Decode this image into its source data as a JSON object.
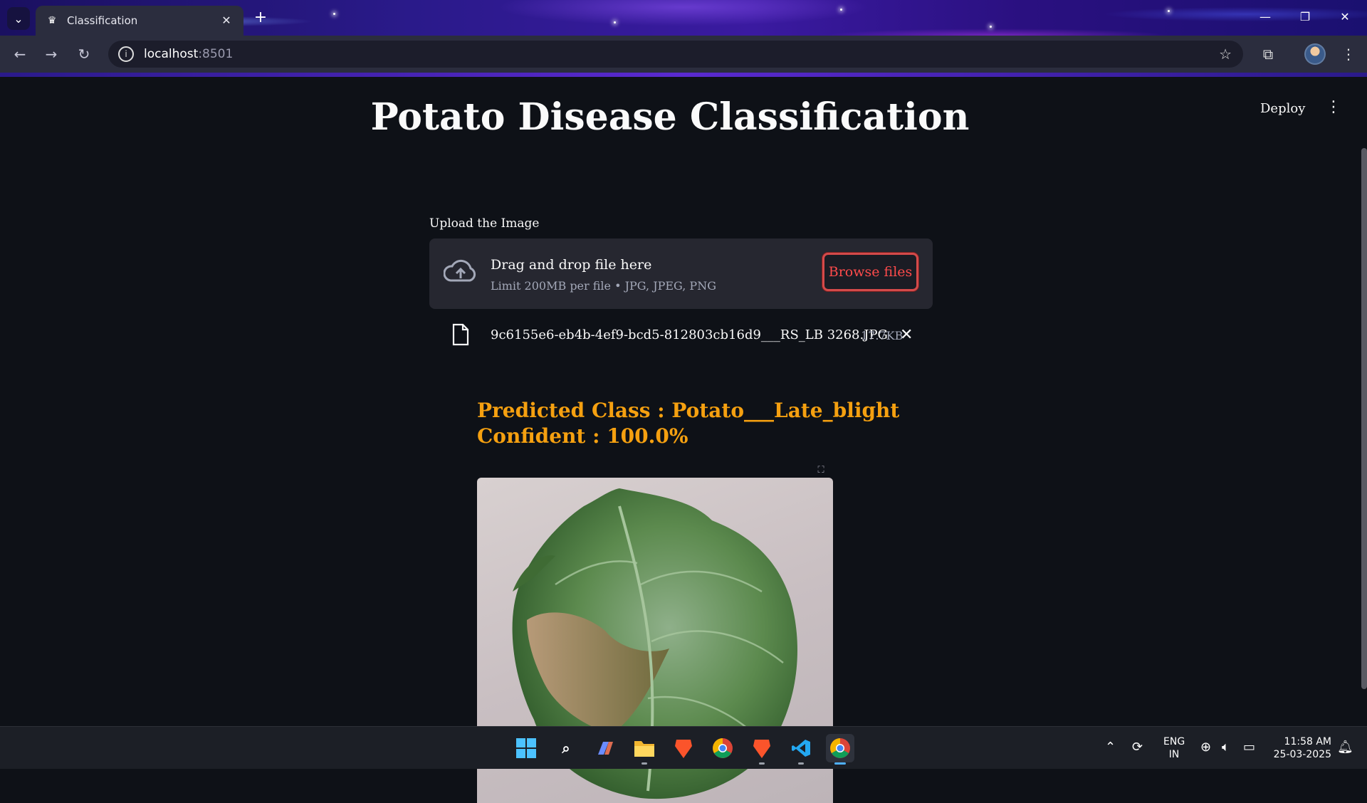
{
  "browser": {
    "tab_title": "Classification",
    "tab_favicon": "streamlit-crown-icon",
    "tab_close": "✕",
    "new_tab": "+",
    "url_host": "localhost",
    "url_port": ":8501",
    "window_controls": {
      "minimize": "—",
      "restore": "❐",
      "close": "✕"
    },
    "theme_colors": {
      "toolbar": "#2b2d3e",
      "omnibox": "#1c1d2b"
    }
  },
  "app": {
    "deploy_label": "Deploy",
    "title": "Potato Disease Classification",
    "uploader": {
      "label": "Upload the Image",
      "drop_title": "Drag and drop file here",
      "drop_subtitle": "Limit 200MB per file • JPG, JPEG, PNG",
      "browse_label": "Browse files"
    },
    "uploaded_file": {
      "name": "9c6155e6-eb4b-4ef9-bcd5-812803cb16d9___RS_LB 3268.JPG",
      "size": "17.7KB"
    },
    "prediction": {
      "class_line": "Predicted Class : Potato___Late_blight",
      "confidence_line": "Confident : 100.0%"
    },
    "colors": {
      "background": "#0e1117",
      "accent": "#ff4b4b",
      "prediction": "#f5a010"
    }
  },
  "taskbar": {
    "apps": [
      {
        "name": "windows-start-icon"
      },
      {
        "name": "search-icon"
      },
      {
        "name": "copilot-icon"
      },
      {
        "name": "file-explorer-icon"
      },
      {
        "name": "brave-browser-icon"
      },
      {
        "name": "chrome-icon"
      },
      {
        "name": "brave-browser-icon"
      },
      {
        "name": "vscode-icon"
      },
      {
        "name": "chrome-icon"
      }
    ],
    "language_top": "ENG",
    "language_bottom": "IN",
    "time": "11:58 AM",
    "date": "25-03-2025"
  }
}
